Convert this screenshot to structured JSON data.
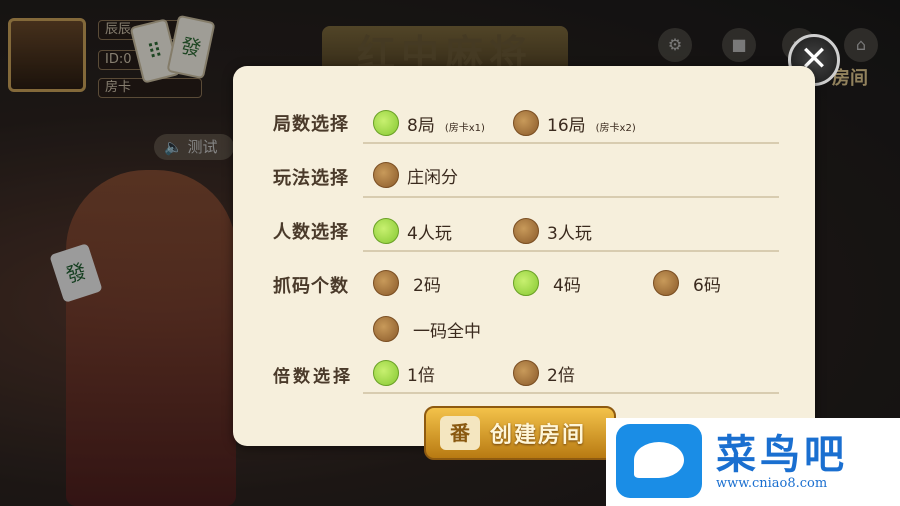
{
  "header": {
    "title": "红中麻将",
    "player_name": "辰辰",
    "player_id": "ID:0",
    "room_card": "房卡",
    "room_label": "房间"
  },
  "side": {
    "test_label": "测试",
    "tile_char": "發",
    "mahjong_tile": "發"
  },
  "dialog": {
    "rows": [
      {
        "label": "局数选择",
        "options": [
          {
            "label": "8局",
            "note": "(房卡x1)",
            "selected": true
          },
          {
            "label": "16局",
            "note": "(房卡x2)",
            "selected": false
          }
        ]
      },
      {
        "label": "玩法选择",
        "options": [
          {
            "label": "庄闲分",
            "note": "",
            "selected": false
          }
        ]
      },
      {
        "label": "人数选择",
        "options": [
          {
            "label": "4人玩",
            "note": "",
            "selected": true
          },
          {
            "label": "3人玩",
            "note": "",
            "selected": false
          }
        ]
      },
      {
        "label": "抓码个数",
        "options": [
          {
            "label": "2码",
            "note": "",
            "selected": false
          },
          {
            "label": "4码",
            "note": "",
            "selected": true
          },
          {
            "label": "6码",
            "note": "",
            "selected": false
          },
          {
            "label": "一码全中",
            "note": "",
            "selected": false
          }
        ]
      },
      {
        "label": "倍数选择",
        "options": [
          {
            "label": "1倍",
            "note": "",
            "selected": true
          },
          {
            "label": "2倍",
            "note": "",
            "selected": false
          }
        ]
      }
    ],
    "create_button": "创建房间",
    "create_icon_char": "番"
  },
  "watermark": {
    "brand": "菜鸟吧",
    "url": "www.cniao8.com"
  },
  "colors": {
    "selected_radio": "#a6dc4a",
    "unselected_radio": "#a8742f",
    "dialog_bg": "#f6efdc",
    "button_gold": "#e0a02c"
  }
}
